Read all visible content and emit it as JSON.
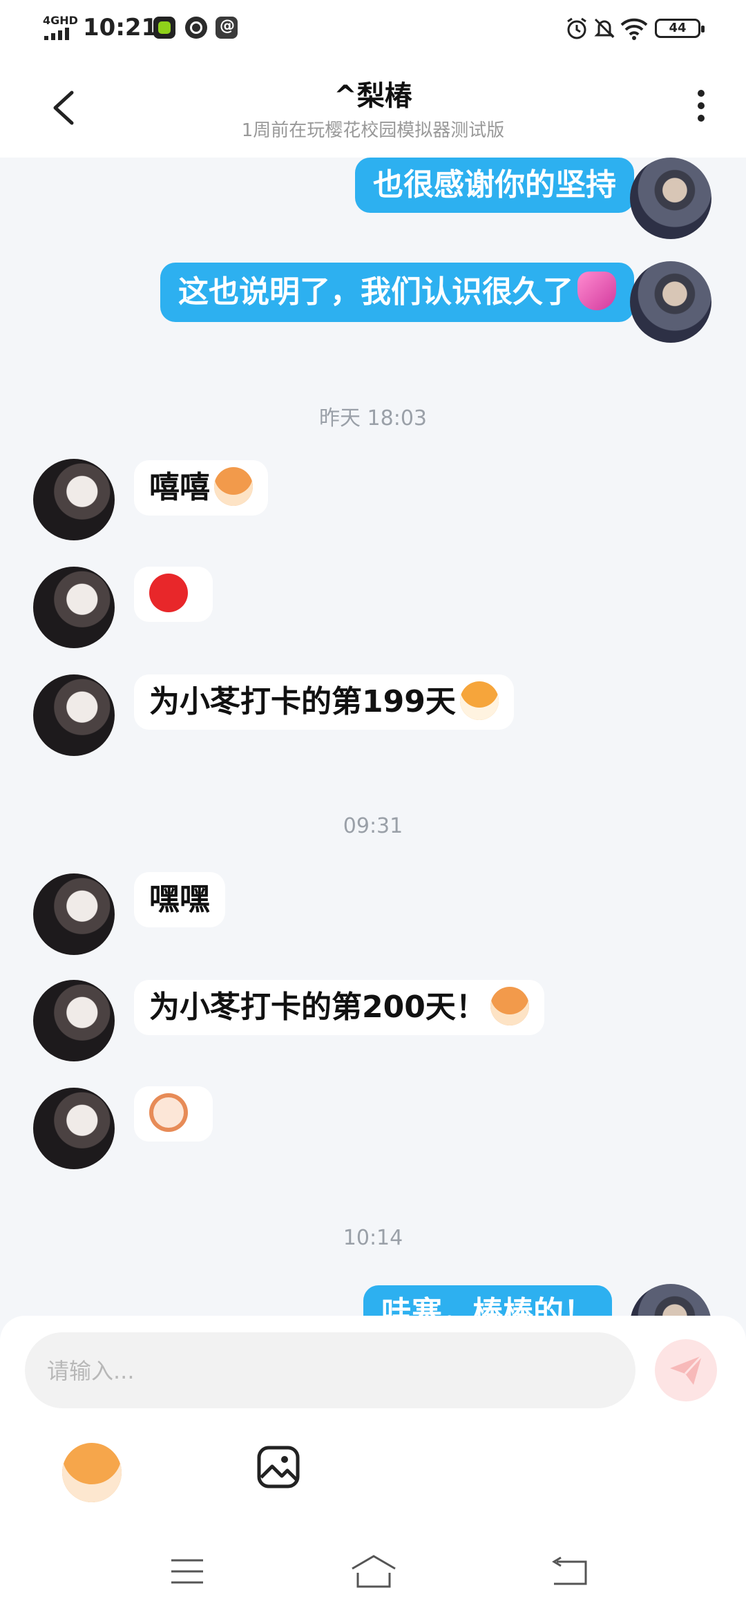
{
  "status_bar": {
    "network": "4GHD",
    "time": "10:21",
    "battery": "44"
  },
  "header": {
    "title": "^梨椿",
    "subtitle": "1周前在玩樱花校园模拟器测试版"
  },
  "messages": [
    {
      "side": "out",
      "text": "也很感谢你的坚持",
      "emoji": ""
    },
    {
      "side": "out",
      "text": "这也说明了，我们认识很久了",
      "emoji": "heart"
    },
    {
      "timestamp": "昨天 18:03"
    },
    {
      "side": "in",
      "text": "嘻嘻",
      "emoji": "monkey"
    },
    {
      "side": "in",
      "text": "",
      "emoji": "red-heart"
    },
    {
      "side": "in",
      "text": "为小苳打卡的第199天",
      "emoji": "tiger"
    },
    {
      "timestamp": "09:31"
    },
    {
      "side": "in",
      "text": "嘿嘿",
      "emoji": ""
    },
    {
      "side": "in",
      "text": "为小苳打卡的第200天！",
      "emoji": "monkey-kiss"
    },
    {
      "side": "in",
      "text": "",
      "emoji": "sheep"
    },
    {
      "timestamp": "10:14"
    },
    {
      "side": "out",
      "text": "哇塞，棒棒的！",
      "emoji": ""
    }
  ],
  "composer": {
    "placeholder": "请输入..."
  },
  "colors": {
    "outgoing_bubble": "#2db0f0",
    "incoming_bubble": "#ffffff",
    "background": "#f4f6f9"
  }
}
